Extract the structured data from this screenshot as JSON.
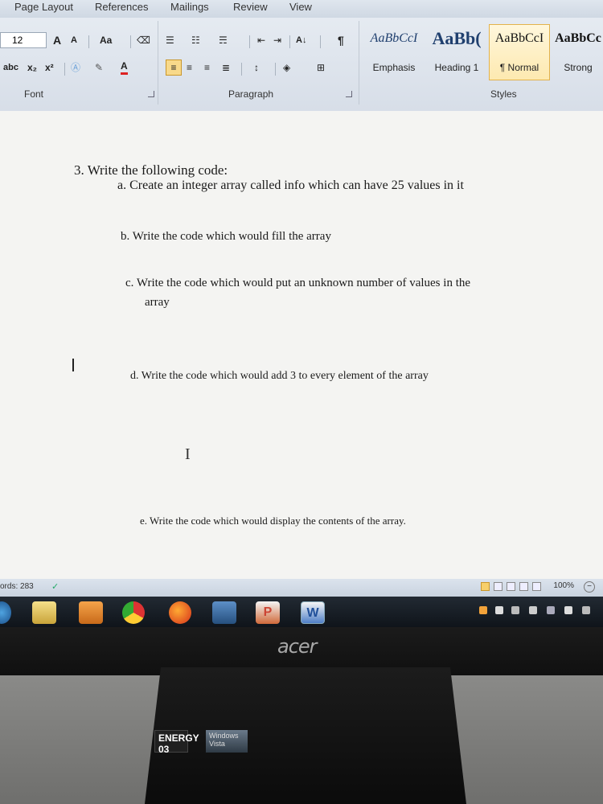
{
  "ribbon": {
    "tabs": [
      "Page Layout",
      "References",
      "Mailings",
      "Review",
      "View"
    ],
    "font": {
      "size": "12",
      "grow": "A",
      "shrink": "A",
      "case": "Aa",
      "strike": "abc",
      "subscript": "x₂",
      "superscript": "x²",
      "font_color": "A",
      "group_label": "Font"
    },
    "paragraph": {
      "sort": "A↓",
      "pilcrow": "¶",
      "group_label": "Paragraph"
    },
    "styles": {
      "items": [
        {
          "sample": "AaBbCcI",
          "name": "Emphasis"
        },
        {
          "sample": "AaBb(",
          "name": "Heading 1"
        },
        {
          "sample": "AaBbCcI",
          "name": "¶ Normal"
        },
        {
          "sample": "AaBbCc",
          "name": "Strong"
        }
      ],
      "group_label": "Styles"
    }
  },
  "document": {
    "question": "3.  Write the following code:",
    "a": "a.   Create an integer array called info which can have 25 values in it",
    "b": "b.   Write the code which would fill the array",
    "c1": "c.   Write the code which would put an unknown number of values in the",
    "c2": "array",
    "d": "d.   Write the code which would add 3 to every element of the array",
    "e": "e.   Write the code which would display the contents of the array."
  },
  "status": {
    "words": "ords: 283",
    "zoom": "100%"
  },
  "monitor": {
    "brand": "acer",
    "sticker1": "ENERGY 03",
    "sticker2": "Windows Vista"
  }
}
